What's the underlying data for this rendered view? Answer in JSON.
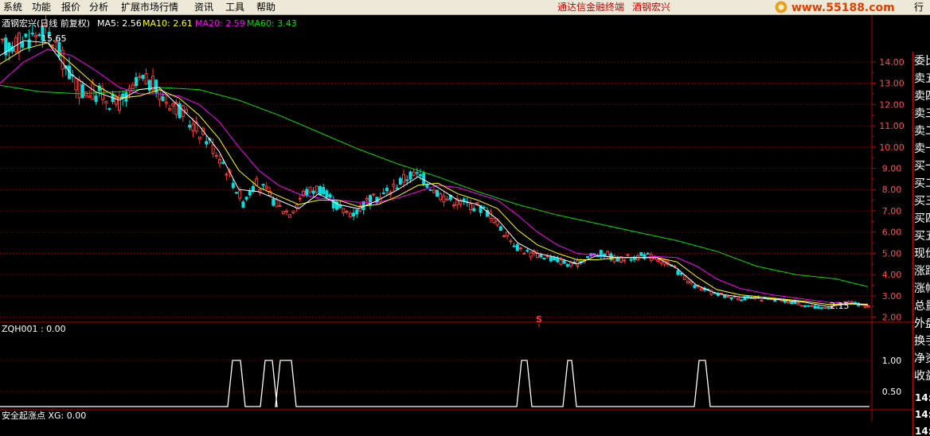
{
  "menu": {
    "items": [
      "系统",
      "功能",
      "报价",
      "分析",
      "扩展市场行情",
      "资讯",
      "工具",
      "帮助"
    ],
    "brand_app": "通达信金融终端",
    "brand_stock": "酒钢宏兴",
    "right_cut": "行情",
    "logo_text": "www.55188.com"
  },
  "legend": {
    "title": "酒钢宏兴(日线 前复权)",
    "ma5_label": "MA5: 2.56",
    "ma10_label": "MA10: 2.61",
    "ma20_label": "MA20: 2.59",
    "ma60_label": "MA60: 3.43"
  },
  "colors": {
    "up": "#ff3c3c",
    "down": "#00e0e0",
    "ma5": "#ffffff",
    "ma10": "#ffff00",
    "ma20": "#ff00ff",
    "ma60": "#00e000",
    "grid": "#8b0000",
    "axis_text": "#ff5050"
  },
  "annotations": {
    "high": "15.65",
    "low": "2.15",
    "signal": "S"
  },
  "indicator": {
    "label": "ZQH001 : 0.00",
    "bottom_label": "安全起涨点 XG: 0.00",
    "axis": [
      "1.00",
      "0.50"
    ]
  },
  "chart_data": {
    "type": "candlestick",
    "price_axis": [
      "14.00",
      "13.00",
      "12.00",
      "11.00",
      "10.00",
      "9.00",
      "8.00",
      "7.00",
      "6.00",
      "5.00",
      "4.00",
      "3.00",
      "2.00"
    ],
    "ylim": [
      1.8,
      16.2
    ],
    "high_mark": 15.65,
    "low_mark": 2.15,
    "price_path": [
      [
        0,
        14.6
      ],
      [
        20,
        14.9
      ],
      [
        40,
        15.2
      ],
      [
        55,
        15.5
      ],
      [
        70,
        14.8
      ],
      [
        85,
        13.6
      ],
      [
        100,
        12.7
      ],
      [
        115,
        12.6
      ],
      [
        130,
        12.4
      ],
      [
        145,
        12.0
      ],
      [
        160,
        12.3
      ],
      [
        175,
        13.1
      ],
      [
        190,
        13.0
      ],
      [
        205,
        12.3
      ],
      [
        220,
        12.0
      ],
      [
        240,
        11.1
      ],
      [
        260,
        10.4
      ],
      [
        280,
        9.3
      ],
      [
        295,
        8.2
      ],
      [
        305,
        7.4
      ],
      [
        320,
        8.3
      ],
      [
        335,
        7.9
      ],
      [
        350,
        7.2
      ],
      [
        365,
        6.9
      ],
      [
        380,
        7.8
      ],
      [
        400,
        8.1
      ],
      [
        415,
        7.5
      ],
      [
        430,
        7.0
      ],
      [
        445,
        6.9
      ],
      [
        460,
        7.4
      ],
      [
        480,
        7.7
      ],
      [
        500,
        8.3
      ],
      [
        515,
        8.7
      ],
      [
        530,
        8.6
      ],
      [
        545,
        8.0
      ],
      [
        560,
        7.6
      ],
      [
        580,
        7.4
      ],
      [
        600,
        7.2
      ],
      [
        615,
        6.9
      ],
      [
        630,
        6.1
      ],
      [
        650,
        5.3
      ],
      [
        665,
        5.0
      ],
      [
        680,
        4.9
      ],
      [
        700,
        4.7
      ],
      [
        720,
        4.4
      ],
      [
        740,
        4.9
      ],
      [
        760,
        5.0
      ],
      [
        775,
        4.7
      ],
      [
        790,
        4.8
      ],
      [
        810,
        4.9
      ],
      [
        830,
        4.7
      ],
      [
        850,
        4.2
      ],
      [
        870,
        3.5
      ],
      [
        890,
        3.2
      ],
      [
        910,
        3.0
      ],
      [
        930,
        2.9
      ],
      [
        960,
        2.85
      ],
      [
        990,
        2.75
      ],
      [
        1010,
        2.6
      ],
      [
        1030,
        2.4
      ],
      [
        1050,
        2.6
      ],
      [
        1070,
        2.7
      ],
      [
        1090,
        2.45
      ]
    ],
    "ma5": [
      [
        0,
        14.3
      ],
      [
        30,
        15.0
      ],
      [
        60,
        14.9
      ],
      [
        90,
        13.4
      ],
      [
        120,
        12.6
      ],
      [
        150,
        12.2
      ],
      [
        175,
        12.7
      ],
      [
        200,
        12.8
      ],
      [
        225,
        11.9
      ],
      [
        250,
        11.0
      ],
      [
        275,
        9.8
      ],
      [
        300,
        8.0
      ],
      [
        325,
        7.9
      ],
      [
        350,
        7.5
      ],
      [
        375,
        7.1
      ],
      [
        400,
        7.8
      ],
      [
        425,
        7.3
      ],
      [
        450,
        7.1
      ],
      [
        475,
        7.5
      ],
      [
        500,
        8.0
      ],
      [
        525,
        8.6
      ],
      [
        550,
        8.1
      ],
      [
        575,
        7.5
      ],
      [
        600,
        7.3
      ],
      [
        625,
        6.6
      ],
      [
        650,
        5.5
      ],
      [
        675,
        5.0
      ],
      [
        700,
        4.8
      ],
      [
        725,
        4.5
      ],
      [
        750,
        4.9
      ],
      [
        775,
        4.8
      ],
      [
        800,
        4.8
      ],
      [
        825,
        4.8
      ],
      [
        850,
        4.3
      ],
      [
        875,
        3.5
      ],
      [
        900,
        3.1
      ],
      [
        930,
        2.95
      ],
      [
        970,
        2.85
      ],
      [
        1010,
        2.7
      ],
      [
        1040,
        2.5
      ],
      [
        1070,
        2.65
      ],
      [
        1090,
        2.56
      ]
    ],
    "ma10": [
      [
        0,
        13.9
      ],
      [
        30,
        14.6
      ],
      [
        60,
        14.9
      ],
      [
        90,
        13.9
      ],
      [
        120,
        12.9
      ],
      [
        150,
        12.3
      ],
      [
        175,
        12.4
      ],
      [
        200,
        12.7
      ],
      [
        225,
        12.3
      ],
      [
        250,
        11.5
      ],
      [
        275,
        10.4
      ],
      [
        300,
        8.9
      ],
      [
        325,
        8.1
      ],
      [
        350,
        7.7
      ],
      [
        375,
        7.3
      ],
      [
        400,
        7.5
      ],
      [
        425,
        7.5
      ],
      [
        450,
        7.2
      ],
      [
        475,
        7.3
      ],
      [
        500,
        7.7
      ],
      [
        525,
        8.2
      ],
      [
        550,
        8.3
      ],
      [
        575,
        7.8
      ],
      [
        600,
        7.5
      ],
      [
        625,
        7.1
      ],
      [
        650,
        6.1
      ],
      [
        675,
        5.4
      ],
      [
        700,
        5.0
      ],
      [
        725,
        4.7
      ],
      [
        750,
        4.7
      ],
      [
        775,
        4.8
      ],
      [
        800,
        4.8
      ],
      [
        825,
        4.8
      ],
      [
        850,
        4.6
      ],
      [
        875,
        3.9
      ],
      [
        900,
        3.3
      ],
      [
        930,
        3.05
      ],
      [
        970,
        2.9
      ],
      [
        1010,
        2.75
      ],
      [
        1040,
        2.6
      ],
      [
        1070,
        2.62
      ],
      [
        1090,
        2.61
      ]
    ],
    "ma20": [
      [
        0,
        13.0
      ],
      [
        30,
        14.0
      ],
      [
        60,
        14.6
      ],
      [
        90,
        14.3
      ],
      [
        120,
        13.6
      ],
      [
        150,
        12.8
      ],
      [
        175,
        12.5
      ],
      [
        200,
        12.5
      ],
      [
        225,
        12.4
      ],
      [
        250,
        12.0
      ],
      [
        275,
        11.2
      ],
      [
        300,
        10.0
      ],
      [
        325,
        8.9
      ],
      [
        350,
        8.2
      ],
      [
        375,
        7.8
      ],
      [
        400,
        7.6
      ],
      [
        425,
        7.5
      ],
      [
        450,
        7.4
      ],
      [
        475,
        7.4
      ],
      [
        500,
        7.6
      ],
      [
        525,
        7.9
      ],
      [
        550,
        8.2
      ],
      [
        575,
        8.1
      ],
      [
        600,
        7.8
      ],
      [
        625,
        7.5
      ],
      [
        650,
        6.8
      ],
      [
        675,
        6.0
      ],
      [
        700,
        5.4
      ],
      [
        725,
        5.0
      ],
      [
        750,
        4.9
      ],
      [
        775,
        4.8
      ],
      [
        800,
        4.8
      ],
      [
        825,
        4.85
      ],
      [
        850,
        4.8
      ],
      [
        875,
        4.4
      ],
      [
        900,
        3.8
      ],
      [
        930,
        3.35
      ],
      [
        970,
        3.05
      ],
      [
        1010,
        2.85
      ],
      [
        1040,
        2.7
      ],
      [
        1070,
        2.63
      ],
      [
        1090,
        2.59
      ]
    ],
    "ma60": [
      [
        0,
        12.9
      ],
      [
        50,
        12.6
      ],
      [
        100,
        12.5
      ],
      [
        150,
        12.6
      ],
      [
        200,
        12.8
      ],
      [
        250,
        12.7
      ],
      [
        300,
        12.2
      ],
      [
        350,
        11.5
      ],
      [
        400,
        10.7
      ],
      [
        450,
        9.9
      ],
      [
        500,
        9.2
      ],
      [
        550,
        8.6
      ],
      [
        600,
        7.9
      ],
      [
        650,
        7.3
      ],
      [
        700,
        6.8
      ],
      [
        750,
        6.4
      ],
      [
        800,
        6.0
      ],
      [
        850,
        5.6
      ],
      [
        900,
        5.1
      ],
      [
        950,
        4.4
      ],
      [
        1000,
        4.0
      ],
      [
        1050,
        3.8
      ],
      [
        1090,
        3.43
      ]
    ],
    "signal": [
      [
        292,
        302
      ],
      [
        333,
        342
      ],
      [
        352,
        366
      ],
      [
        655,
        662
      ],
      [
        713,
        718
      ],
      [
        878,
        886
      ]
    ],
    "signal_x": 677
  }
}
